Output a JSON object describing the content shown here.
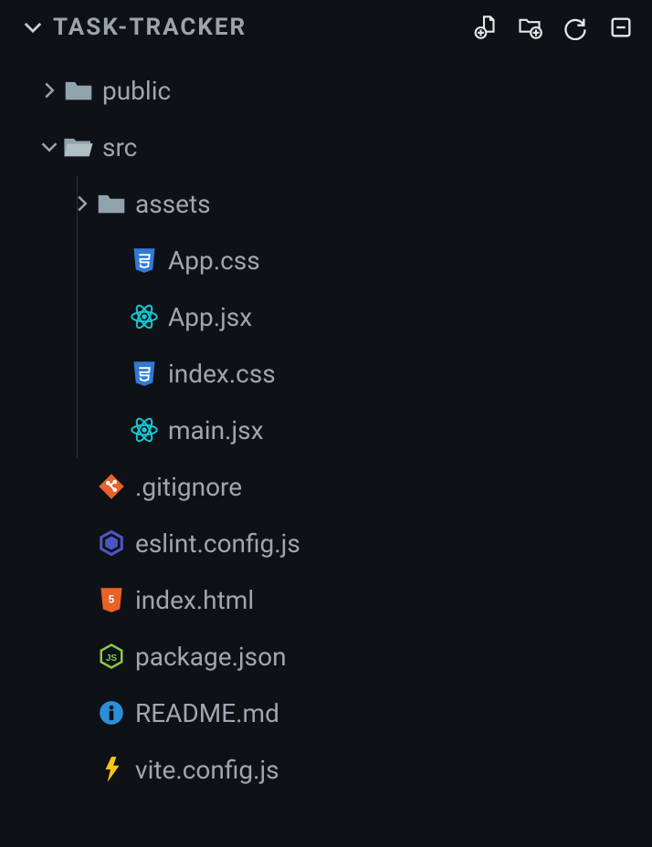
{
  "project": {
    "title": "TASK-TRACKER"
  },
  "tree": {
    "public": {
      "label": "public"
    },
    "src": {
      "label": "src"
    },
    "assets": {
      "label": "assets"
    },
    "app_css": {
      "label": "App.css"
    },
    "app_jsx": {
      "label": "App.jsx"
    },
    "index_css": {
      "label": "index.css"
    },
    "main_jsx": {
      "label": "main.jsx"
    },
    "gitignore": {
      "label": ".gitignore"
    },
    "eslint": {
      "label": "eslint.config.js"
    },
    "index_html": {
      "label": "index.html"
    },
    "package_json": {
      "label": "package.json"
    },
    "readme": {
      "label": "README.md"
    },
    "vite_config": {
      "label": "vite.config.js"
    }
  }
}
